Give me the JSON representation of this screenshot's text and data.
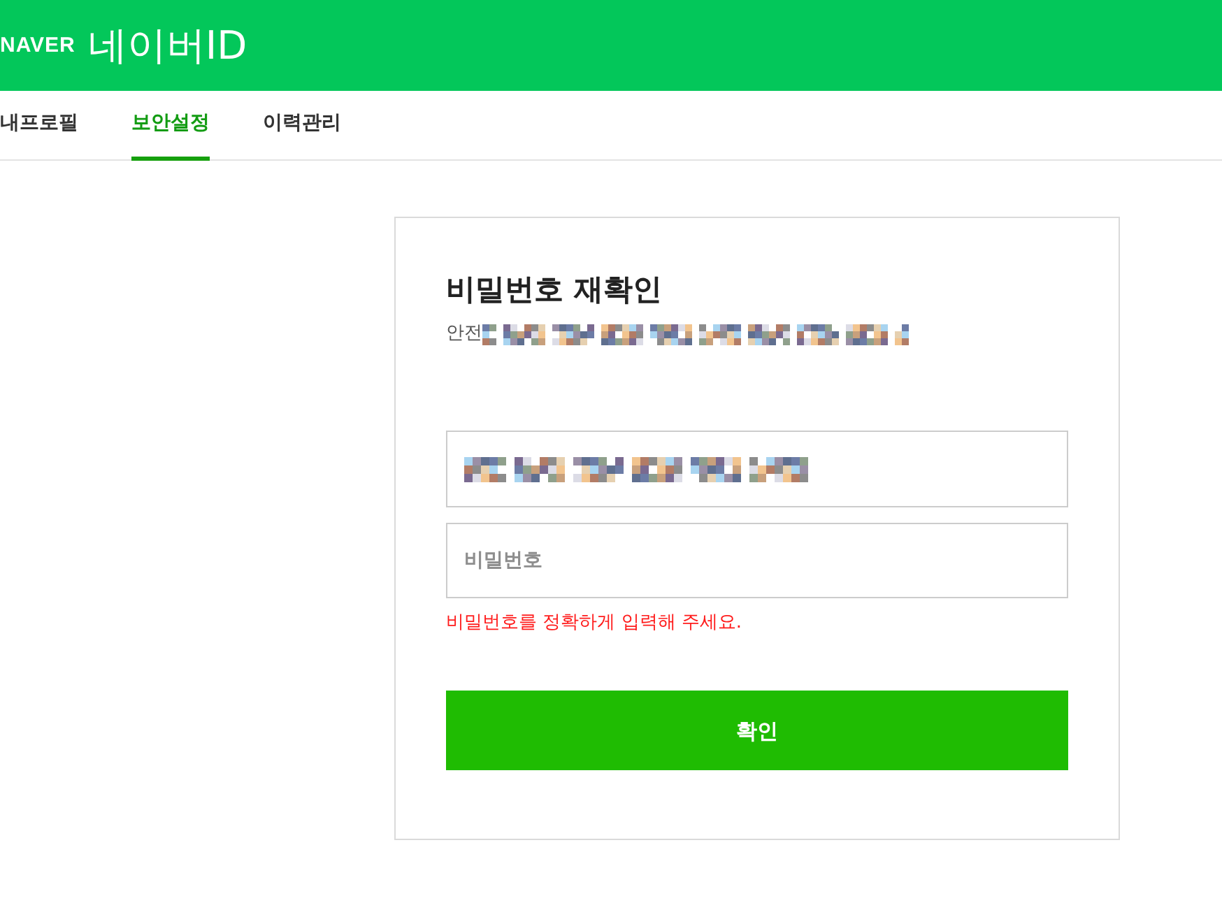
{
  "header": {
    "logo": "NAVER",
    "title": "네이버ID"
  },
  "tabs": [
    {
      "label": "내프로필",
      "selected": false
    },
    {
      "label": "보안설정",
      "selected": true
    },
    {
      "label": "이력관리",
      "selected": false
    }
  ],
  "card": {
    "title": "비밀번호 재확인",
    "subtitle": "안전",
    "fields": [
      {
        "kind": "redacted"
      },
      {
        "kind": "password",
        "placeholder": "비밀번호"
      }
    ],
    "error": "비밀번호를 정확하게 입력해 주세요.",
    "button": "확인"
  }
}
